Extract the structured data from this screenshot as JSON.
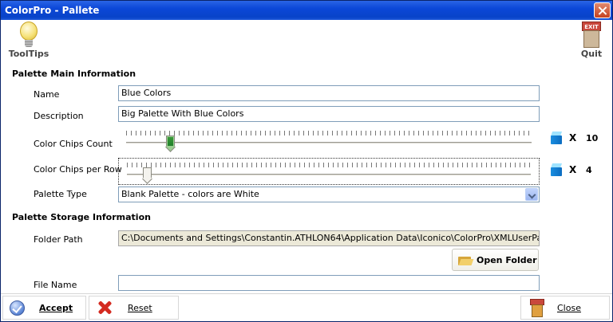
{
  "window": {
    "title": "ColorPro - Pallete"
  },
  "toolbar": {
    "tooltips_label": "ToolTips",
    "quit_label": "Quit",
    "exit_sign_text": "EXIT"
  },
  "main_info": {
    "section_title": "Palette Main Information",
    "name_label": "Name",
    "name_value": "Blue Colors",
    "description_label": "Description",
    "description_value": "Big Palette With Blue Colors",
    "chips_count_label": "Color Chips Count",
    "chips_count_value": "10",
    "chips_count_slider_fraction": 0.1,
    "chips_per_row_label": "Color Chips per Row",
    "chips_per_row_value": "4",
    "chips_per_row_slider_fraction": 0.04,
    "times_symbol": "X",
    "palette_type_label": "Palette Type",
    "palette_type_value": "Blank Palette - colors are White"
  },
  "storage_info": {
    "section_title": "Palette Storage Information",
    "folder_path_label": "Folder Path",
    "folder_path_value": "C:\\Documents and Settings\\Constantin.ATHLON64\\Application Data\\Iconico\\ColorPro\\XMLUserPalettes",
    "open_folder_label": "Open Folder",
    "file_name_label": "File Name",
    "file_name_value": ""
  },
  "bottom": {
    "accept_label": "Accept",
    "reset_label": "Reset",
    "close_label": "Close"
  },
  "colors": {
    "titlebar": "#0b47d8",
    "chip": "#1a8ee0",
    "slider_thumb_active": "#3a9a3a"
  }
}
